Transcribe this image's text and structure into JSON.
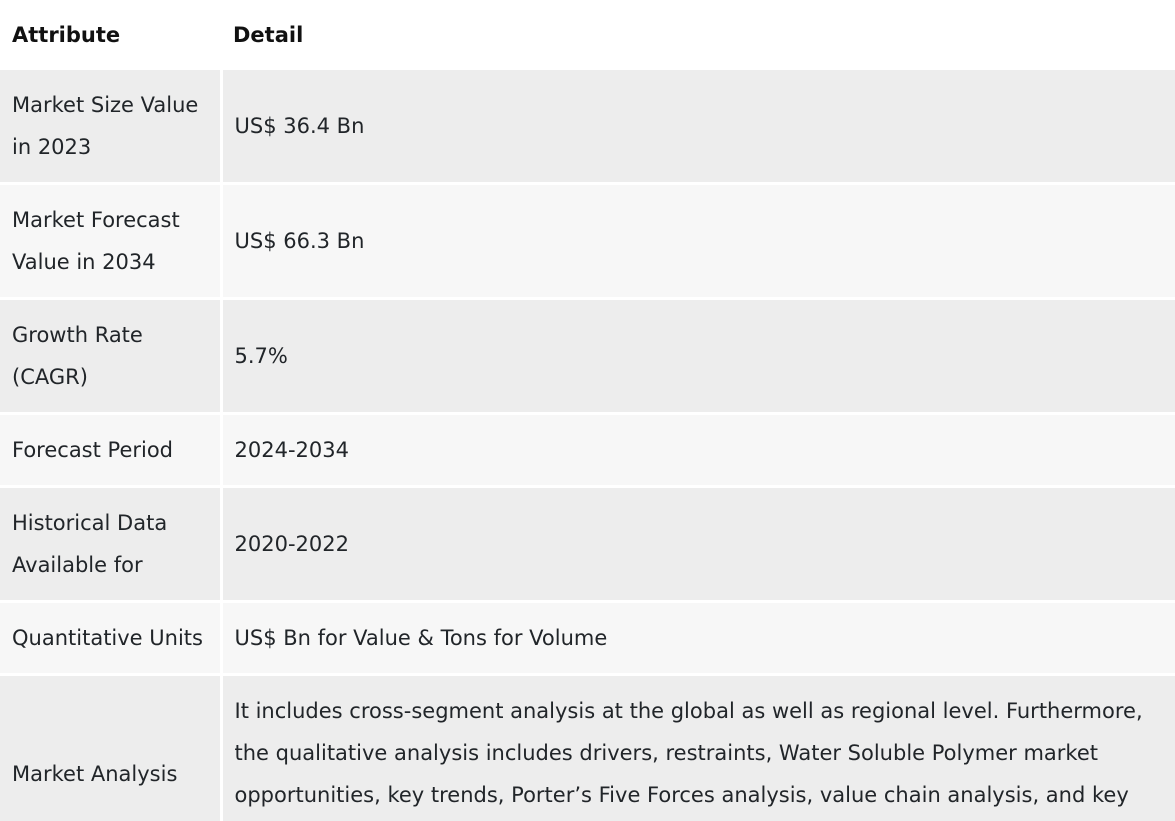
{
  "table": {
    "headers": [
      "Attribute",
      "Detail"
    ],
    "rows": [
      {
        "attribute": "Market Size Value in 2023",
        "detail": "US$ 36.4 Bn"
      },
      {
        "attribute": "Market Forecast Value in 2034",
        "detail": "US$ 66.3 Bn"
      },
      {
        "attribute": "Growth Rate (CAGR)",
        "detail": "5.7%"
      },
      {
        "attribute": "Forecast Period",
        "detail": "2024-2034"
      },
      {
        "attribute": "Historical Data Available for",
        "detail": "2020-2022"
      },
      {
        "attribute": "Quantitative Units",
        "detail": "US$ Bn for Value & Tons for Volume"
      },
      {
        "attribute": "Market Analysis",
        "detail": "It includes cross-segment analysis at the global as well as regional level. Furthermore, the qualitative analysis includes drivers, restraints, Water Soluble Polymer market opportunities, key trends, Porter’s Five Forces analysis, value chain analysis, and key trend analysis."
      }
    ]
  }
}
